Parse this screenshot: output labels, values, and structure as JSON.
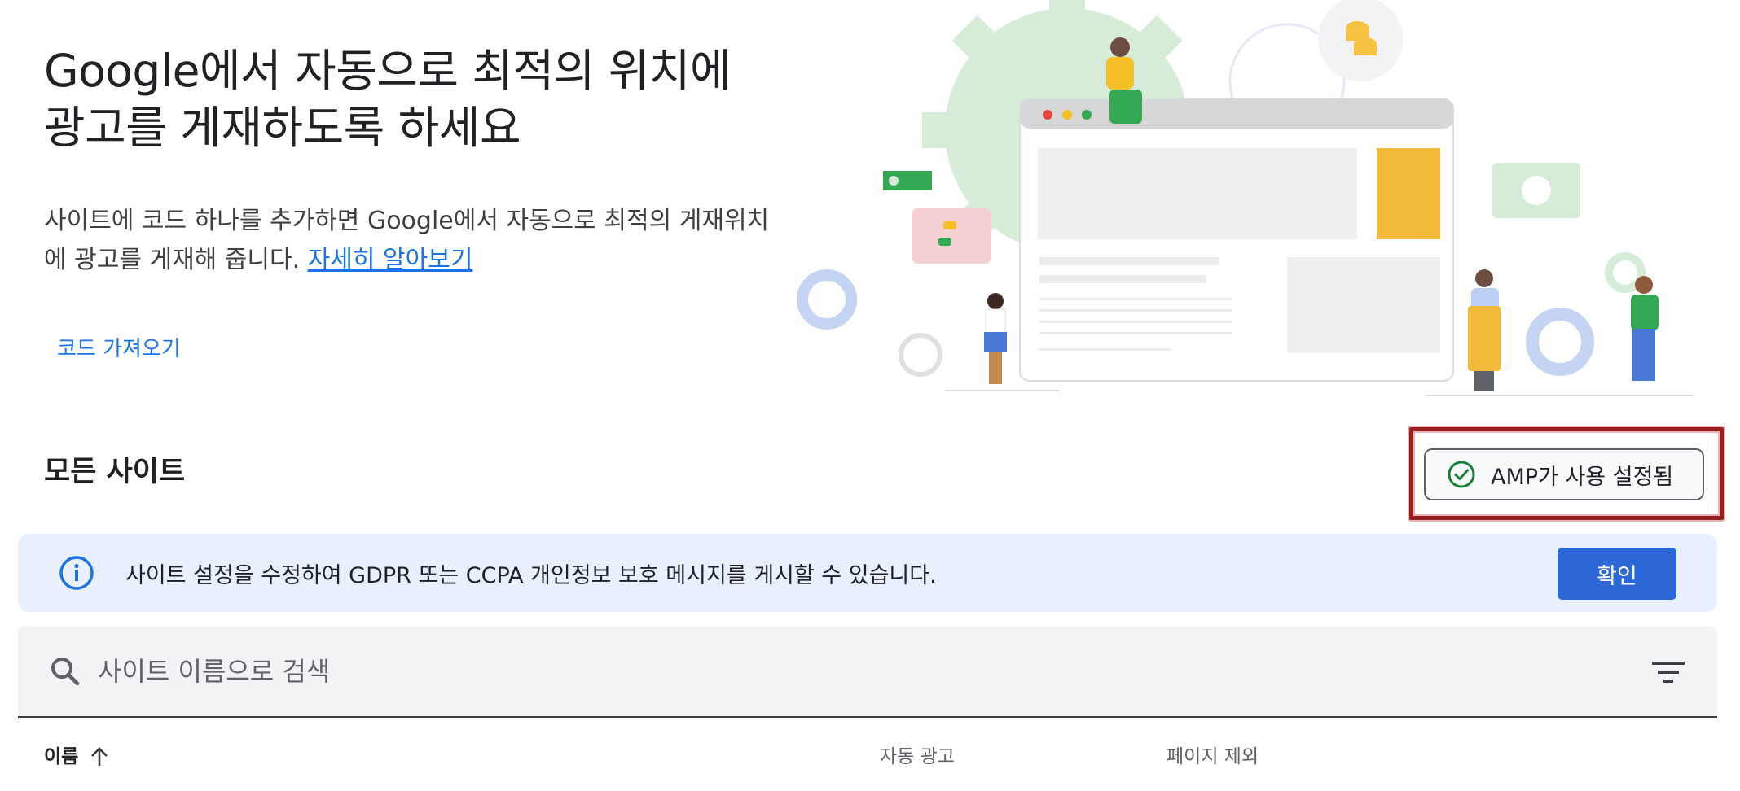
{
  "hero": {
    "title": "Google에서 자동으로 최적의 위치에 광고를 게재하도록 하세요",
    "description": "사이트에 코드 하나를 추가하면 Google에서 자동으로 최적의 게재위치에 광고를 게재해 줍니다. ",
    "learn_more": "자세히 알아보기",
    "get_code": "코드 가져오기"
  },
  "section": {
    "title": "모든 사이트",
    "amp_chip": "AMP가 사용 설정됨"
  },
  "banner": {
    "message": "사이트 설정을 수정하여 GDPR 또는 CCPA 개인정보 보호 메시지를 게시할 수 있습니다.",
    "confirm": "확인"
  },
  "search": {
    "placeholder": "사이트 이름으로 검색"
  },
  "table": {
    "columns": [
      "이름",
      "자동 광고",
      "페이지 제외"
    ]
  },
  "colors": {
    "accent": "#1a73e8",
    "button": "#2b67d6",
    "banner_bg": "#e8f0fe",
    "check": "#188038"
  }
}
